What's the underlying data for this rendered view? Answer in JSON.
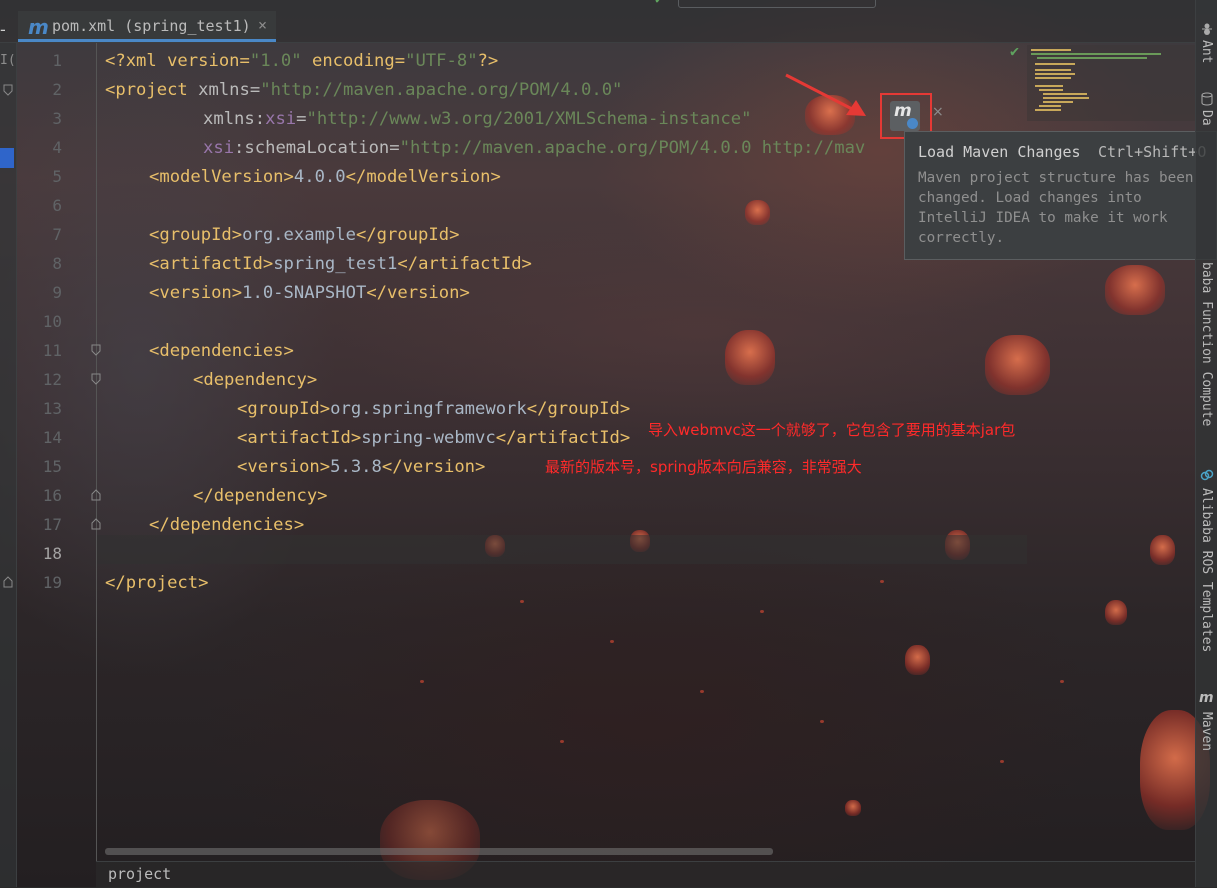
{
  "window": {
    "tab_title": "pom.xml (spring_test1)",
    "tab_icon": "maven-m-icon",
    "tab_close": "×",
    "left_strip_label": "I(",
    "top_dash": "-"
  },
  "editor": {
    "line_numbers": [
      "1",
      "2",
      "3",
      "4",
      "5",
      "6",
      "7",
      "8",
      "9",
      "10",
      "11",
      "12",
      "13",
      "14",
      "15",
      "16",
      "17",
      "18",
      "19"
    ],
    "current_line": "18",
    "lines": {
      "l1_open": "<?xml version=",
      "l1_v1": "\"1.0\"",
      "l1_mid": " encoding=",
      "l1_v2": "\"UTF-8\"",
      "l1_end": "?>",
      "l2_tag": "<project ",
      "l2_attr": "xmlns=",
      "l2_val": "\"http://maven.apache.org/POM/4.0.0\"",
      "l3_attr": "xmlns:",
      "l3_ns": "xsi",
      "l3_eq": "=",
      "l3_val": "\"http://www.w3.org/2001/XMLSchema-instance\"",
      "l4_ns": "xsi",
      "l4_attr": ":schemaLocation=",
      "l4_val": "\"http://maven.apache.org/POM/4.0.0 http://mav",
      "l5_open": "<modelVersion>",
      "l5_text": "4.0.0",
      "l5_close": "</modelVersion>",
      "l7_open": "<groupId>",
      "l7_text": "org.example",
      "l7_close": "</groupId>",
      "l8_open": "<artifactId>",
      "l8_text": "spring_test1",
      "l8_close": "</artifactId>",
      "l9_open": "<version>",
      "l9_text": "1.0-SNAPSHOT",
      "l9_close": "</version>",
      "l11": "<dependencies>",
      "l12": "<dependency>",
      "l13_open": "<groupId>",
      "l13_text": "org.springframework",
      "l13_close": "</groupId>",
      "l14_open": "<artifactId>",
      "l14_text": "spring-webmvc",
      "l14_close": "</artifactId>",
      "l15_open": "<version>",
      "l15_text": "5.3.8",
      "l15_close": "</version>",
      "l16": "</dependency>",
      "l17": "</dependencies>",
      "l19": "</project>"
    }
  },
  "maven_popup": {
    "button_icon": "maven-reload-icon",
    "button_letter": "m",
    "close": "×",
    "tooltip_title": "Load Maven Changes",
    "tooltip_shortcut": "Ctrl+Shift+O",
    "tooltip_desc": "Maven project structure has been changed. Load changes into IntelliJ IDEA to make it work correctly."
  },
  "annotations": {
    "note1": "导入webmvc这一个就够了，它包含了要用的基本jar包",
    "note2": "最新的版本号，spring版本向后兼容，非常强大"
  },
  "right_tools": {
    "ant": "Ant",
    "database": "Da",
    "function_compute": "baba Function Compute",
    "ros_templates": "Alibaba ROS Templates",
    "maven": "Maven"
  },
  "status": {
    "breadcrumb": "project"
  },
  "colors": {
    "tag": "#e8bf6a",
    "attribute_value": "#6a8759",
    "namespace": "#9876aa",
    "annotation": "#ff2a2a",
    "accent": "#4a88c7"
  }
}
